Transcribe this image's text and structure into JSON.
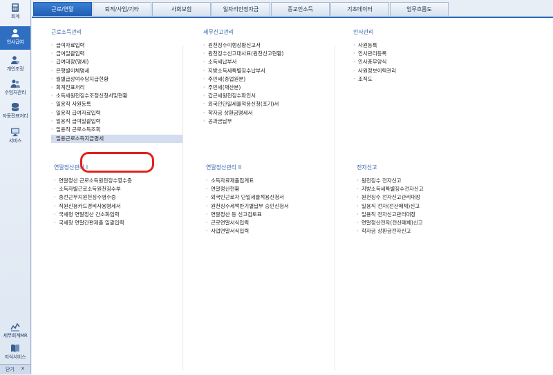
{
  "sidebar": {
    "items": [
      {
        "label": "회계",
        "icon": "calculator-icon"
      },
      {
        "label": "인사급여",
        "icon": "person-icon",
        "active": true
      },
      {
        "label": "개인조정",
        "icon": "person-adjust-icon"
      },
      {
        "label": "수임처관리",
        "icon": "people-icon"
      },
      {
        "label": "자동전표처리",
        "icon": "database-icon"
      },
      {
        "label": "서비스",
        "icon": "monitor-icon"
      },
      {
        "label": "세무회계MR",
        "icon": "chart-icon"
      },
      {
        "label": "지식서비스",
        "icon": "book-icon"
      }
    ],
    "close_label": "닫기",
    "close_icon": "close-icon"
  },
  "tabs": [
    {
      "label": "근로/연말",
      "active": true
    },
    {
      "label": "퇴직/사업/기타"
    },
    {
      "label": "사회보험"
    },
    {
      "label": "일자리안정자금"
    },
    {
      "label": "종교인소득"
    },
    {
      "label": "기초데이터"
    },
    {
      "label": "업무흐름도"
    }
  ],
  "sections": [
    {
      "title": "근로소득관리",
      "items": [
        "급여자료입력",
        "급여일괄입력",
        "급여대장(명세)",
        "은행별이체명세",
        "월별급상여수당지급현황",
        "회계전표처리",
        "소득세원천징수조정신청서및현황",
        "일용직 사원등록",
        "일용직 급여자료입력",
        "일용직 급여일괄입력",
        "일용직 근로소득조회",
        "일용근로소득지급명세"
      ],
      "highlight": 11
    },
    {
      "title": "세무신고관리",
      "items": [
        "원천징수이행상황신고서",
        "원천징수신고대사표(원천신고현황)",
        "소득세납부서",
        "지방소득세특별징수납부서",
        "주민세(종업원분)",
        "주민세(재산분)",
        "갑근세원천징수확인서",
        "외국인단일세율적용신청(포기)서",
        "학자금 상환금명세서",
        "공과금납부"
      ]
    },
    {
      "title": "인사관리",
      "items": [
        "사원등록",
        "인사관리등록",
        "인사총무양식",
        "사원정보이력관리",
        "조직도"
      ]
    },
    {
      "title": "연말정산관리 I",
      "items": [
        "연말정산 근로소득원천징수영수증",
        "소득자별근로소득원천징수부",
        "종전근무지원천징수영수증",
        "직원신용카드경비사용명세서",
        "국세청 연말정산 간소화입력",
        "국세청 연말간편제출 일괄입력"
      ]
    },
    {
      "title": "연말정산관리 II",
      "items": [
        "소득자료제출집계표",
        "연말정산현황",
        "외국인근로자 단일세율적용신청서",
        "원천징수세액반기별납부 승인신청서",
        "연말정산 등 신고검토표",
        "근로연말서식입력",
        "사업연말서식입력"
      ]
    },
    {
      "title": "전자신고",
      "items": [
        "원천징수 전자신고",
        "지방소득세특별징수전자신고",
        "원천징수 전자신고관리대장",
        "일용직 전자(전산매체)신고",
        "일용직 전자신고관리대장",
        "연말정산전자(전산매체)신고",
        "학자금 상환금전자신고"
      ]
    }
  ]
}
